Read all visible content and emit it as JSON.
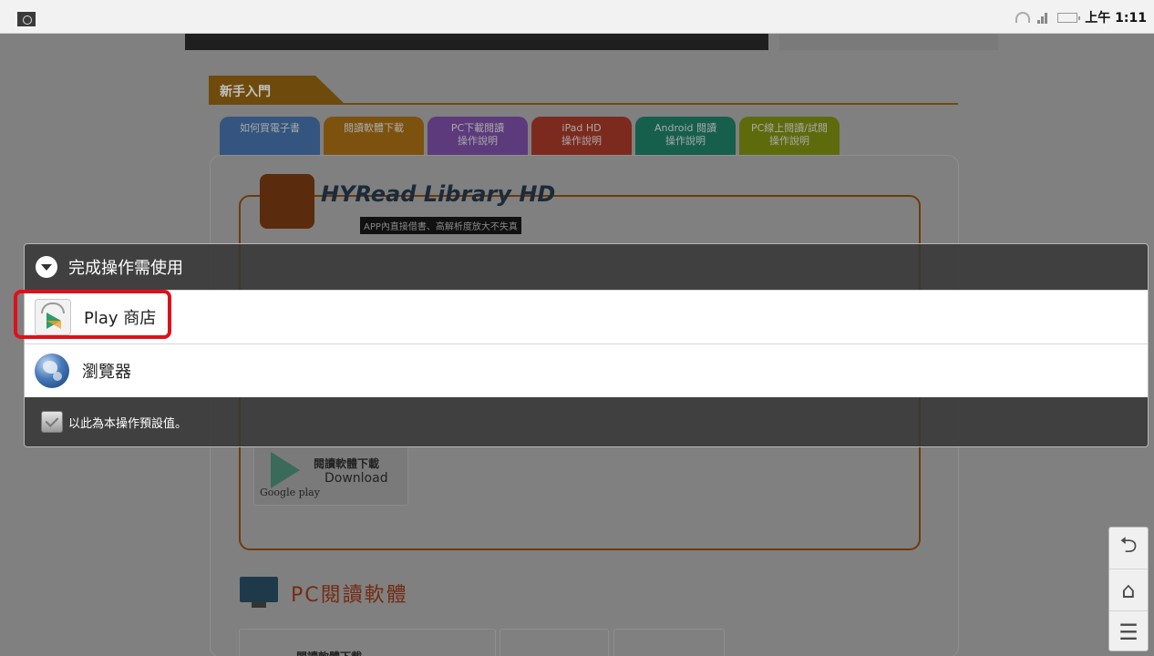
{
  "status_bar": {
    "time": "上午 1:11"
  },
  "background": {
    "section_title": "新手入門",
    "tabs": [
      {
        "l1": "如何買電子書",
        "l2": "",
        "color": "#33557f"
      },
      {
        "l1": "閱讀軟體下載",
        "l2": "",
        "color": "#7d520f"
      },
      {
        "l1": "PC下載閱讀",
        "l2": "操作說明",
        "color": "#5c3a7c"
      },
      {
        "l1": "iPad HD",
        "l2": "操作說明",
        "color": "#7d2a1e"
      },
      {
        "l1": "Android 閱讀",
        "l2": "操作說明",
        "color": "#165f4d"
      },
      {
        "l1": "PC線上閱讀/試閱",
        "l2": "操作說明",
        "color": "#5e6b0c"
      }
    ],
    "product_title": "HYRead Library HD",
    "product_subtitle": "APP內直接借書、高解析度放大不失真",
    "google_play": {
      "line1": "閱讀軟體下載",
      "line2": "Download",
      "brand": "Google play"
    },
    "pc_title": "PC閱讀軟體",
    "pc_download_label": "閱讀軟體下載"
  },
  "dialog": {
    "title": "完成操作需使用",
    "options": [
      {
        "label": "Play 商店",
        "icon": "play-store-icon"
      },
      {
        "label": "瀏覽器",
        "icon": "browser-globe-icon"
      }
    ],
    "checkbox_label": "以此為本操作預設值。",
    "highlight_color": "#e0101a"
  },
  "nav": {
    "back": "⮌",
    "home": "⌂",
    "menu": "☰"
  }
}
